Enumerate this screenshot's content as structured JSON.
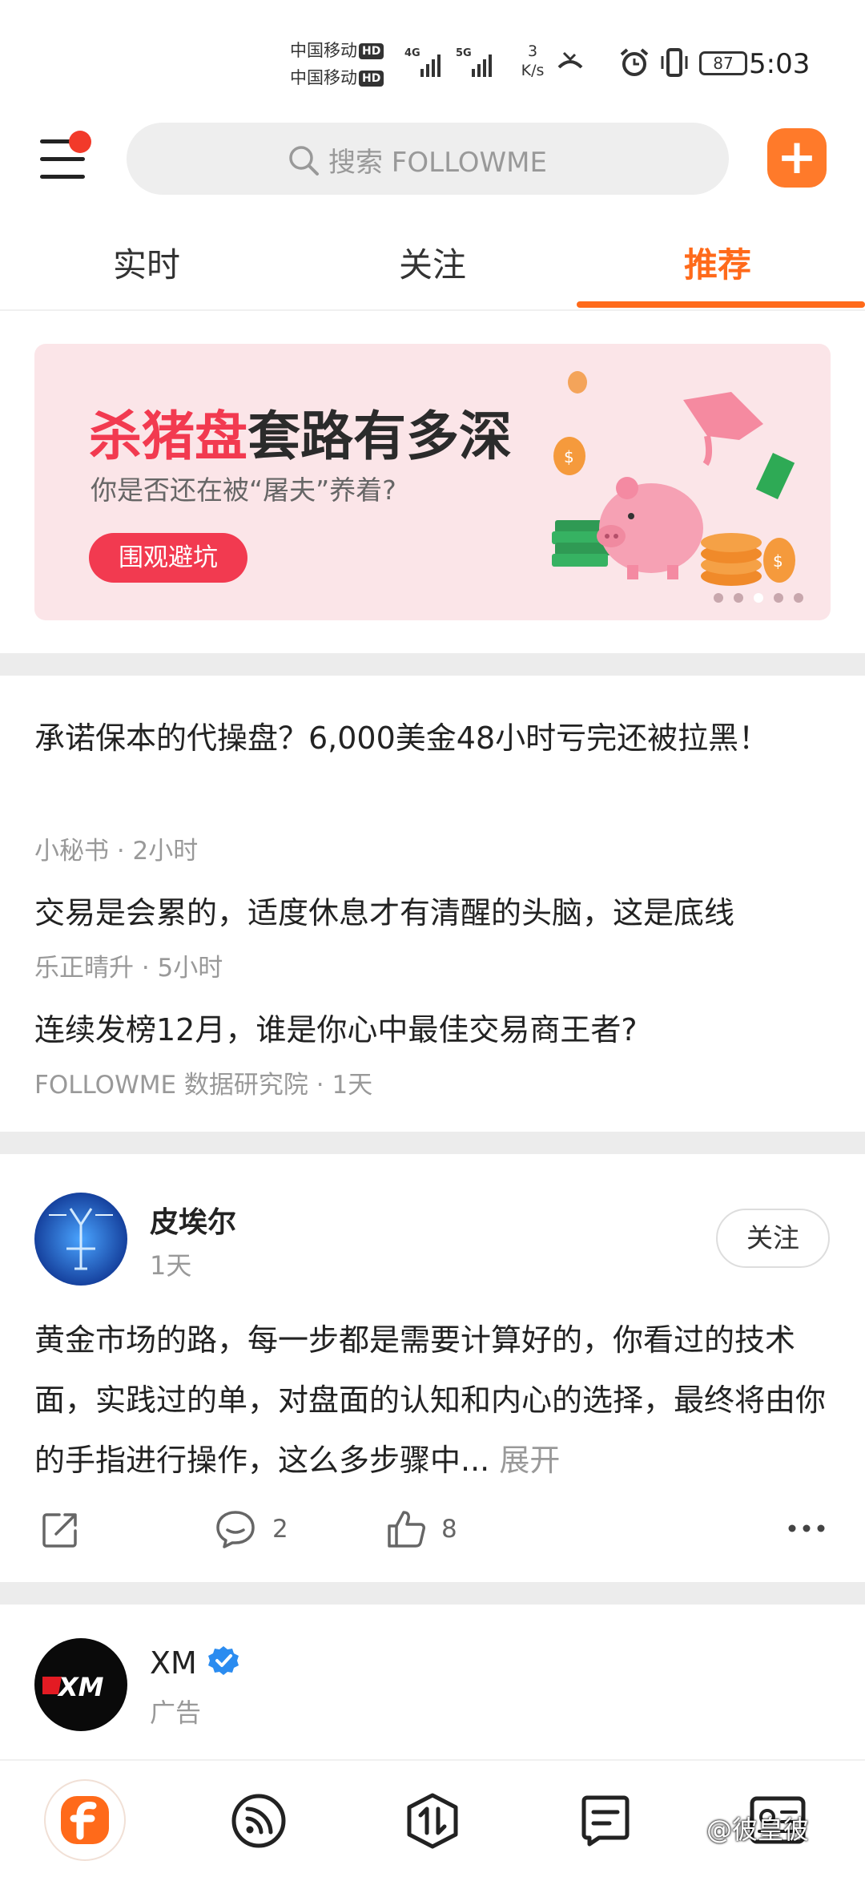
{
  "status_bar": {
    "carrier_1": "中国移动",
    "carrier_2": "中国移动",
    "hd": "HD",
    "network_4g": "4G",
    "network_5g": "5G",
    "speed_value": "3",
    "speed_unit": "K/s",
    "battery": "87",
    "time": "5:03"
  },
  "header": {
    "search_placeholder": "搜索 FOLLOWME"
  },
  "tabs": [
    {
      "label": "实时",
      "active": false
    },
    {
      "label": "关注",
      "active": false
    },
    {
      "label": "推荐",
      "active": true
    }
  ],
  "banner": {
    "title_highlight": "杀猪盘",
    "title_rest": "套路有多深",
    "subtitle": "你是否还在被“屠夫”养着?",
    "button": "围观避坑",
    "active_dot": 3,
    "dot_count": 5
  },
  "news": [
    {
      "title": "承诺保本的代操盘？6,000美金48小时亏完还被拉黑！",
      "meta": "小秘书 · 2小时"
    },
    {
      "title": "交易是会累的，适度休息才有清醒的头脑，这是底线",
      "meta": "乐正晴升 · 5小时"
    },
    {
      "title": "连续发榜12月，谁是你心中最佳交易商王者?",
      "meta": "FOLLOWME 数据研究院 · 1天"
    }
  ],
  "post": {
    "author": "皮埃尔",
    "time": "1天",
    "follow": "关注",
    "body": "黄金市场的路，每一步都是需要计算好的，你看过的技术面，实践过的单，对盘面的认知和内心的选择，最终将由你的手指进行操作，这么多步骤中...",
    "expand": "展开",
    "comments": "2",
    "likes": "8"
  },
  "ad": {
    "author": "XM",
    "label": "广告",
    "logo_text": "XM"
  },
  "watermark": "@彼皇彼",
  "colors": {
    "accent": "#ff6a1a",
    "banner_red": "#f23a50",
    "separator": "#ececec"
  }
}
